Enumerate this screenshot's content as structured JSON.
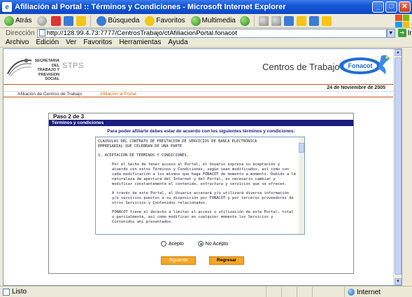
{
  "window": {
    "title": "Afiliación al Portal :: Términos y Condiciones - Microsoft Internet Explorer",
    "minimize": "_",
    "maximize": "□",
    "close": "✕"
  },
  "toolbar": {
    "back": "Atrás",
    "search": "Búsqueda",
    "favorites": "Favoritos",
    "multimedia": "Multimedia"
  },
  "address": {
    "label": "Dirección",
    "url": "http://128.99.4.73:7777/CentrosTrabajo/ctAfiliacionPortal.fonacot",
    "go": "Ir"
  },
  "menu": [
    "Archivo",
    "Edición",
    "Ver",
    "Favoritos",
    "Herramientas",
    "Ayuda"
  ],
  "header": {
    "org_line1": "SECRETARIA DEL",
    "org_line2": "TRABAJO Y",
    "org_line3": "PREVISION SOCIAL",
    "stps": "STPS",
    "title": "Centros de Trabajo",
    "fonacot": "Fonacot",
    "date": "24 de Noviembre de 2005"
  },
  "nav": {
    "item1": "Afiliación de Centros de Trabajo",
    "item2": "Afiliación al Portal"
  },
  "form": {
    "step": "Paso 2 de 3",
    "section": "Términos y condiciones",
    "intro": "Para poder afiliarte debes estar de acuerdo con los siguientes términos y condiciones:",
    "terms": {
      "heading1": "CLAUSULAS DEL CONTRATO DE PRESTACION DE SERVICIOS DE BANCA ELECTRÓNICA",
      "heading2": "EMPRESARIAL QUE CELEBRAN DE UNA PARTE",
      "section1": "1. ACEPTACIÓN DE TÉRMINOS Y CONDICIONES.",
      "p1": "Por el hecho de tener acceso al Portal, el Usuario expresa su aceptación y acuerdo con estos Términos y Condiciones, según sean modificados, así como con cada modificación a los mismos que haga FONACOT de momento a momento. Debido a la naturaleza de apertura del Internet y del Portal, es necesario cambiar y modificar constantemente el contenido, estructura y servicios que se ofrecen.",
      "p2": "A través de este Portal, el Usuario accesará y/o utilizará diversa información y/o servicios puestos a su disposición por FONACOT y por terceros proveedores de otros Servicios y Contenidos relacionados.",
      "p3": "FONACOT tiene el derecho a limitar el acceso o utilización de este Portal, total o parcialmente, así como modificar en cualquier momento los Servicios y Contenidos ahí presentados."
    },
    "accept": "Acepto",
    "decline": "No Acepto",
    "selected": "No Acepto",
    "next": "Siguiente",
    "back": "Regresar"
  },
  "status": {
    "text": "Listo",
    "zone": "Internet"
  }
}
